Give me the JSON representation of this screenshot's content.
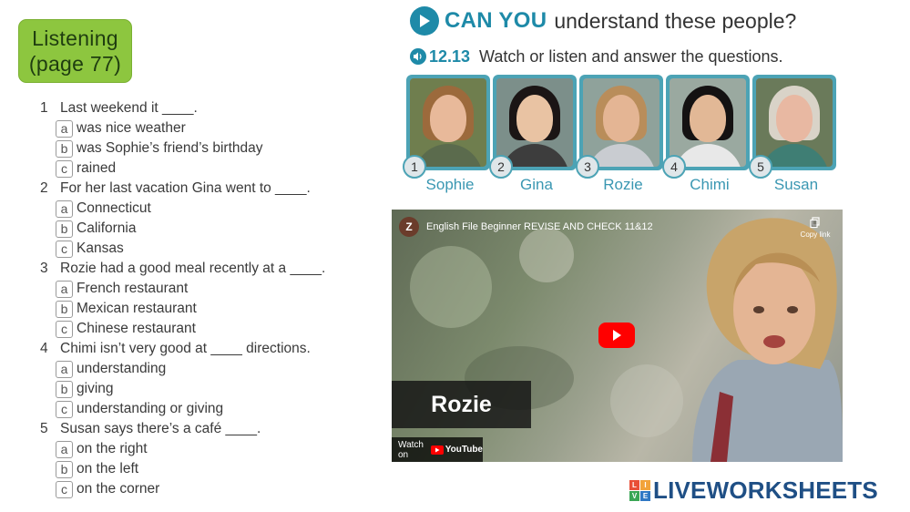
{
  "badge": {
    "line1": "Listening",
    "line2": "(page 77)"
  },
  "heading": {
    "can": "CAN YOU",
    "rest": "understand these people?"
  },
  "instruction": {
    "track": "12.13",
    "text": "Watch or listen and answer the questions."
  },
  "people": [
    {
      "num": "1",
      "name": "Sophie"
    },
    {
      "num": "2",
      "name": "Gina"
    },
    {
      "num": "3",
      "name": "Rozie"
    },
    {
      "num": "4",
      "name": "Chimi"
    },
    {
      "num": "5",
      "name": "Susan"
    }
  ],
  "questions": [
    {
      "num": "1",
      "text": "Last weekend it ____.",
      "options": [
        {
          "letter": "a",
          "text": "was nice weather"
        },
        {
          "letter": "b",
          "text": "was Sophie’s friend’s birthday"
        },
        {
          "letter": "c",
          "text": "rained"
        }
      ]
    },
    {
      "num": "2",
      "text": "For her last vacation Gina went to ____.",
      "options": [
        {
          "letter": "a",
          "text": "Connecticut"
        },
        {
          "letter": "b",
          "text": "California"
        },
        {
          "letter": "c",
          "text": "Kansas"
        }
      ]
    },
    {
      "num": "3",
      "text": "Rozie had a good meal recently at a ____.",
      "options": [
        {
          "letter": "a",
          "text": "French restaurant"
        },
        {
          "letter": "b",
          "text": "Mexican restaurant"
        },
        {
          "letter": "c",
          "text": "Chinese restaurant"
        }
      ]
    },
    {
      "num": "4",
      "text": "Chimi isn’t very good at ____ directions.",
      "options": [
        {
          "letter": "a",
          "text": "understanding"
        },
        {
          "letter": "b",
          "text": "giving"
        },
        {
          "letter": "c",
          "text": "understanding or giving"
        }
      ]
    },
    {
      "num": "5",
      "text": "Susan says there’s a café ____.",
      "options": [
        {
          "letter": "a",
          "text": "on the right"
        },
        {
          "letter": "b",
          "text": "on the left"
        },
        {
          "letter": "c",
          "text": "on the corner"
        }
      ]
    }
  ],
  "video": {
    "channel_initial": "Z",
    "title": "English File Beginner REVISE AND CHECK 11&12",
    "copy_link": "Copy link",
    "name_caption": "Rozie",
    "watch_on": "Watch on",
    "youtube": "YouTube"
  },
  "footer": {
    "brand": "LIVEWORKSHEETS",
    "grid": [
      "L",
      "I",
      "V",
      "E"
    ]
  },
  "colors": {
    "green_badge": "#8dc63f",
    "teal": "#1e8aa8",
    "youtube_red": "#ff0000",
    "brand_blue": "#1f4f85"
  }
}
